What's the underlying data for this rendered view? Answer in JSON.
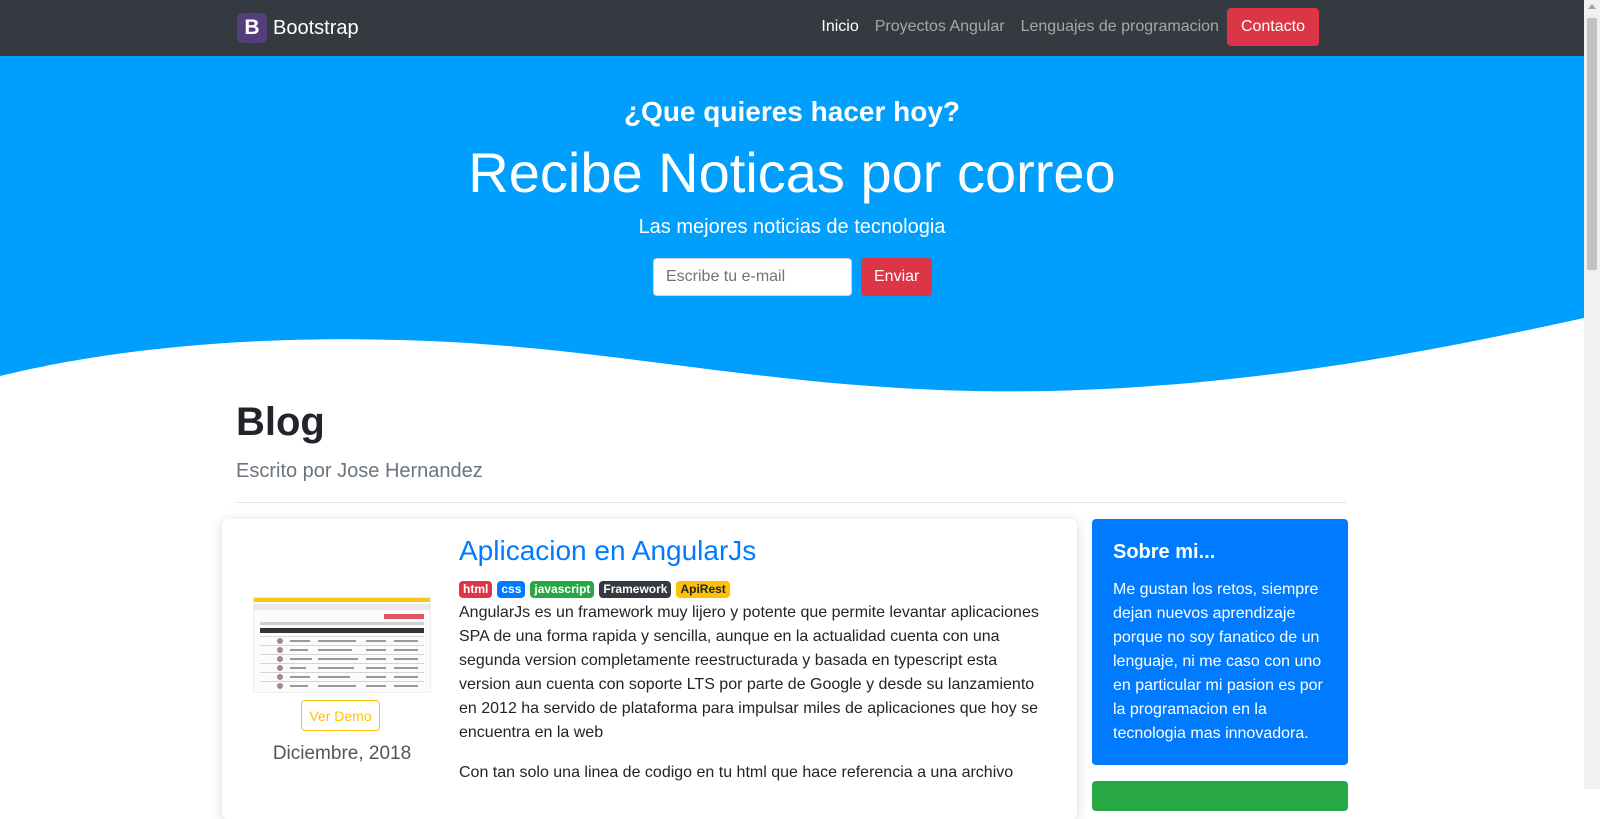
{
  "navbar": {
    "brand_letter": "B",
    "brand_name": "Bootstrap",
    "links": [
      {
        "label": "Inicio",
        "active": true
      },
      {
        "label": "Proyectos Angular",
        "active": false
      },
      {
        "label": "Lenguajes de programacion",
        "active": false
      }
    ],
    "contact_label": "Contacto",
    "color": "#343a40"
  },
  "hero": {
    "kicker": "¿Que quieres hacer hoy?",
    "title": "Recibe Noticas por correo",
    "subtitle": "Las mejores noticias de tecnologia",
    "email_placeholder": "Escribe tu e-mail",
    "send_label": "Enviar",
    "background": "#009ffd"
  },
  "blog": {
    "title": "Blog",
    "author": "Escrito por Jose Hernandez"
  },
  "article": {
    "title": "Aplicacion en AngularJs",
    "tags": [
      {
        "label": "html",
        "color": "#dc3545"
      },
      {
        "label": "css",
        "color": "#007bff"
      },
      {
        "label": "javascript",
        "color": "#28a745"
      },
      {
        "label": "Framework",
        "color": "#343a40"
      },
      {
        "label": "ApiRest",
        "color": "#ffc107"
      }
    ],
    "paragraph1": "AngularJs es un framework muy lijero y potente que permite levantar aplicaciones SPA de una forma rapida y sencilla, aunque en la actualidad cuenta con una segunda version completamente reestructurada y basada en typescript esta version aun cuenta con soporte LTS por parte de Google y desde su lanzamiento en 2012 ha servido de plataforma para impulsar miles de aplicaciones que hoy se encuentra en la web",
    "paragraph2": "Con tan solo una linea de codigo en tu html que hace referencia a una archivo",
    "demo_label": "Ver Demo",
    "date": "Diciembre, 2018"
  },
  "sidebar": {
    "about_title": "Sobre mi...",
    "about_text": "Me gustan los retos, siempre dejan nuevos aprendizaje porque no soy fanatico de un lenguaje, ni me caso con uno en particular mi pasion es por la programacion en la tecnologia mas innovadora.",
    "about_color": "#007bff",
    "next_card_color": "#28a745"
  }
}
